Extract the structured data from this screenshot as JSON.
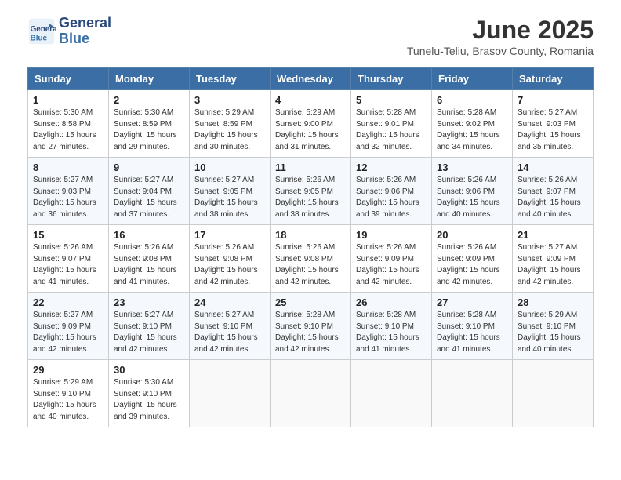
{
  "header": {
    "logo_line1": "General",
    "logo_line2": "Blue",
    "month_title": "June 2025",
    "location": "Tunelu-Teliu, Brasov County, Romania"
  },
  "days_of_week": [
    "Sunday",
    "Monday",
    "Tuesday",
    "Wednesday",
    "Thursday",
    "Friday",
    "Saturday"
  ],
  "weeks": [
    [
      {
        "day": "1",
        "info": "Sunrise: 5:30 AM\nSunset: 8:58 PM\nDaylight: 15 hours\nand 27 minutes."
      },
      {
        "day": "2",
        "info": "Sunrise: 5:30 AM\nSunset: 8:59 PM\nDaylight: 15 hours\nand 29 minutes."
      },
      {
        "day": "3",
        "info": "Sunrise: 5:29 AM\nSunset: 8:59 PM\nDaylight: 15 hours\nand 30 minutes."
      },
      {
        "day": "4",
        "info": "Sunrise: 5:29 AM\nSunset: 9:00 PM\nDaylight: 15 hours\nand 31 minutes."
      },
      {
        "day": "5",
        "info": "Sunrise: 5:28 AM\nSunset: 9:01 PM\nDaylight: 15 hours\nand 32 minutes."
      },
      {
        "day": "6",
        "info": "Sunrise: 5:28 AM\nSunset: 9:02 PM\nDaylight: 15 hours\nand 34 minutes."
      },
      {
        "day": "7",
        "info": "Sunrise: 5:27 AM\nSunset: 9:03 PM\nDaylight: 15 hours\nand 35 minutes."
      }
    ],
    [
      {
        "day": "8",
        "info": "Sunrise: 5:27 AM\nSunset: 9:03 PM\nDaylight: 15 hours\nand 36 minutes."
      },
      {
        "day": "9",
        "info": "Sunrise: 5:27 AM\nSunset: 9:04 PM\nDaylight: 15 hours\nand 37 minutes."
      },
      {
        "day": "10",
        "info": "Sunrise: 5:27 AM\nSunset: 9:05 PM\nDaylight: 15 hours\nand 38 minutes."
      },
      {
        "day": "11",
        "info": "Sunrise: 5:26 AM\nSunset: 9:05 PM\nDaylight: 15 hours\nand 38 minutes."
      },
      {
        "day": "12",
        "info": "Sunrise: 5:26 AM\nSunset: 9:06 PM\nDaylight: 15 hours\nand 39 minutes."
      },
      {
        "day": "13",
        "info": "Sunrise: 5:26 AM\nSunset: 9:06 PM\nDaylight: 15 hours\nand 40 minutes."
      },
      {
        "day": "14",
        "info": "Sunrise: 5:26 AM\nSunset: 9:07 PM\nDaylight: 15 hours\nand 40 minutes."
      }
    ],
    [
      {
        "day": "15",
        "info": "Sunrise: 5:26 AM\nSunset: 9:07 PM\nDaylight: 15 hours\nand 41 minutes."
      },
      {
        "day": "16",
        "info": "Sunrise: 5:26 AM\nSunset: 9:08 PM\nDaylight: 15 hours\nand 41 minutes."
      },
      {
        "day": "17",
        "info": "Sunrise: 5:26 AM\nSunset: 9:08 PM\nDaylight: 15 hours\nand 42 minutes."
      },
      {
        "day": "18",
        "info": "Sunrise: 5:26 AM\nSunset: 9:08 PM\nDaylight: 15 hours\nand 42 minutes."
      },
      {
        "day": "19",
        "info": "Sunrise: 5:26 AM\nSunset: 9:09 PM\nDaylight: 15 hours\nand 42 minutes."
      },
      {
        "day": "20",
        "info": "Sunrise: 5:26 AM\nSunset: 9:09 PM\nDaylight: 15 hours\nand 42 minutes."
      },
      {
        "day": "21",
        "info": "Sunrise: 5:27 AM\nSunset: 9:09 PM\nDaylight: 15 hours\nand 42 minutes."
      }
    ],
    [
      {
        "day": "22",
        "info": "Sunrise: 5:27 AM\nSunset: 9:09 PM\nDaylight: 15 hours\nand 42 minutes."
      },
      {
        "day": "23",
        "info": "Sunrise: 5:27 AM\nSunset: 9:10 PM\nDaylight: 15 hours\nand 42 minutes."
      },
      {
        "day": "24",
        "info": "Sunrise: 5:27 AM\nSunset: 9:10 PM\nDaylight: 15 hours\nand 42 minutes."
      },
      {
        "day": "25",
        "info": "Sunrise: 5:28 AM\nSunset: 9:10 PM\nDaylight: 15 hours\nand 42 minutes."
      },
      {
        "day": "26",
        "info": "Sunrise: 5:28 AM\nSunset: 9:10 PM\nDaylight: 15 hours\nand 41 minutes."
      },
      {
        "day": "27",
        "info": "Sunrise: 5:28 AM\nSunset: 9:10 PM\nDaylight: 15 hours\nand 41 minutes."
      },
      {
        "day": "28",
        "info": "Sunrise: 5:29 AM\nSunset: 9:10 PM\nDaylight: 15 hours\nand 40 minutes."
      }
    ],
    [
      {
        "day": "29",
        "info": "Sunrise: 5:29 AM\nSunset: 9:10 PM\nDaylight: 15 hours\nand 40 minutes."
      },
      {
        "day": "30",
        "info": "Sunrise: 5:30 AM\nSunset: 9:10 PM\nDaylight: 15 hours\nand 39 minutes."
      },
      {
        "day": "",
        "info": ""
      },
      {
        "day": "",
        "info": ""
      },
      {
        "day": "",
        "info": ""
      },
      {
        "day": "",
        "info": ""
      },
      {
        "day": "",
        "info": ""
      }
    ]
  ]
}
